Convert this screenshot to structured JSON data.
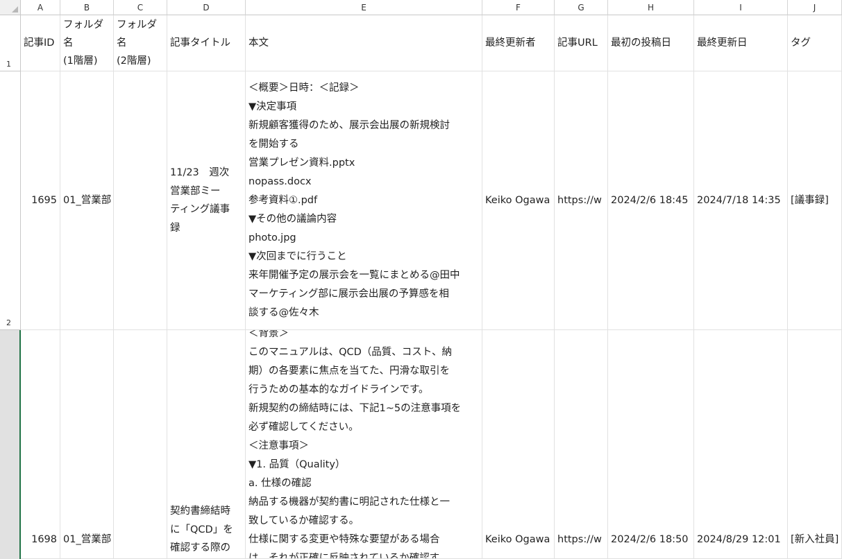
{
  "columns": [
    "A",
    "B",
    "C",
    "D",
    "E",
    "F",
    "G",
    "H",
    "I",
    "J"
  ],
  "row_numbers": [
    "1",
    "2"
  ],
  "headers": [
    "記事ID",
    "フォルダ\n名\n(1階層)",
    "フォルダ\n名\n(2階層)",
    "記事タイトル",
    "本文",
    "最終更新者",
    "記事URL",
    "最初の投稿日",
    "最終更新日",
    "タグ"
  ],
  "rows": [
    {
      "id": "1695",
      "folder1": "01_営業部",
      "folder2": "",
      "title": "11/23　週次\n営業部ミー\nティング議事\n録",
      "body": "＜概要＞日時：＜記録＞\n▼決定事項\n新規顧客獲得のため、展示会出展の新規検討\nを開始する\n営業プレゼン資料.pptx\nnopass.docx\n参考資料①.pdf\n▼その他の議論内容\nphoto.jpg\n▼次回までに行うこと\n来年開催予定の展示会を一覧にまとめる@田中\nマーケティング部に展示会出展の予算感を相\n談する@佐々木",
      "updater": "Keiko Ogawa",
      "url": "https://w",
      "first_post": "2024/2/6 18:45",
      "last_update": "2024/7/18 14:35",
      "tag": "[議事録]"
    },
    {
      "id": "1698",
      "folder1": "01_営業部",
      "folder2": "",
      "title": "契約書締結時\nに「QCD」を\n確認する際の",
      "body": "＜背景＞\nこのマニュアルは、QCD（品質、コスト、納\n期）の各要素に焦点を当てた、円滑な取引を\n行うための基本的なガイドラインです。\n新規契約の締結時には、下記1~5の注意事項を\n必ず確認してください。\n＜注意事項＞\n▼1. 品質（Quality）\na. 仕様の確認\n納品する機器が契約書に明記された仕様と一\n致しているか確認する。\n仕様に関する変更や特殊な要望がある場合\nは、それが正確に反映されているか確認す",
      "updater": "Keiko Ogawa",
      "url": "https://w",
      "first_post": "2024/2/6 18:50",
      "last_update": "2024/8/29 12:01",
      "tag": "[新入社員]"
    }
  ]
}
